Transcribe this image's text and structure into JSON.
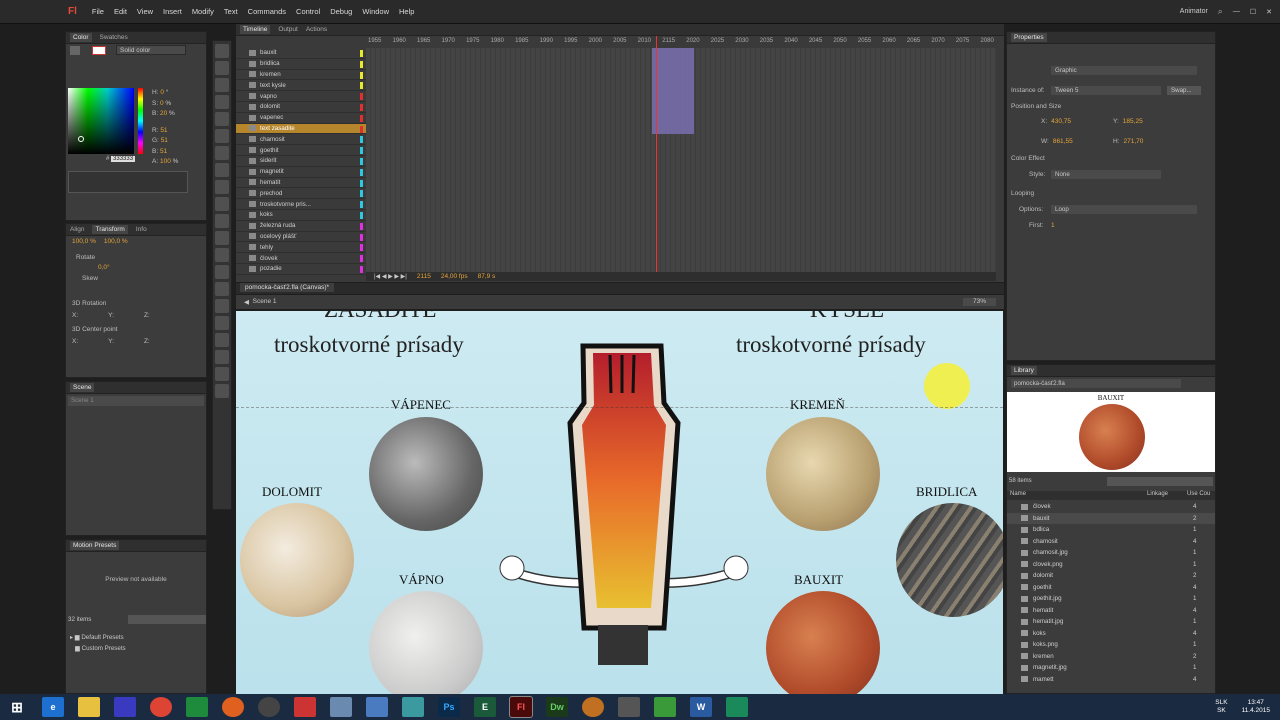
{
  "app": {
    "logo": "Fl",
    "workspace": "Animator"
  },
  "menu": [
    "File",
    "Edit",
    "View",
    "Insert",
    "Modify",
    "Text",
    "Commands",
    "Control",
    "Debug",
    "Window",
    "Help"
  ],
  "color_panel": {
    "tabs": [
      "Color",
      "Swatches"
    ],
    "fill_type": "Solid color",
    "h": "0",
    "s": "0",
    "b": "20",
    "r": "51",
    "g": "51",
    "bl": "51",
    "a": "100",
    "hex": "333333",
    "unit_deg": "°",
    "unit_pct": "%"
  },
  "transform_panel": {
    "tabs": [
      "Align",
      "Transform",
      "Info"
    ],
    "w": "100,0 %",
    "h": "100,0 %",
    "rotate": "Rotate",
    "rotate_val": "0,0°",
    "skew": "Skew",
    "rotation3d": "3D Rotation",
    "center3d": "3D Center point",
    "x": "X:",
    "y": "Y:",
    "z": "Z:"
  },
  "scene_panel": {
    "title": "Scene",
    "item": "Scene 1"
  },
  "motion_presets": {
    "title": "Motion Presets",
    "preview": "Preview not available",
    "count": "32 items",
    "folders": [
      "Default Presets",
      "Custom Presets"
    ]
  },
  "timeline": {
    "tabs": [
      "Timeline",
      "Output",
      "Actions"
    ],
    "ruler": [
      "1955",
      "1960",
      "1965",
      "1970",
      "1975",
      "1980",
      "1985",
      "1990",
      "1995",
      "2000",
      "2005",
      "2010",
      "2115",
      "2020",
      "2025",
      "2030",
      "2035",
      "2040",
      "2045",
      "2050",
      "2055",
      "2060",
      "2065",
      "2070",
      "2075",
      "2080"
    ],
    "layers": [
      {
        "name": "bauxit",
        "color": "#e8e830"
      },
      {
        "name": "bridlica",
        "color": "#e8e830"
      },
      {
        "name": "kremen",
        "color": "#e8e830"
      },
      {
        "name": "text kysle",
        "color": "#e8e830"
      },
      {
        "name": "vapno",
        "color": "#e03030"
      },
      {
        "name": "dolomit",
        "color": "#e03030"
      },
      {
        "name": "vapenec",
        "color": "#e03030"
      },
      {
        "name": "text zasadite",
        "color": "#e03030",
        "selected": true
      },
      {
        "name": "chamosit",
        "color": "#30c8e0"
      },
      {
        "name": "goethit",
        "color": "#30c8e0"
      },
      {
        "name": "siderit",
        "color": "#30c8e0"
      },
      {
        "name": "magnetit",
        "color": "#30c8e0"
      },
      {
        "name": "hematit",
        "color": "#30c8e0"
      },
      {
        "name": "prechod",
        "color": "#30c8e0"
      },
      {
        "name": "troskotvorne pris...",
        "color": "#30c8e0"
      },
      {
        "name": "koks",
        "color": "#30c8e0"
      },
      {
        "name": "železná ruda",
        "color": "#e030e0"
      },
      {
        "name": "ocelový plášť",
        "color": "#e030e0"
      },
      {
        "name": "tehly",
        "color": "#e030e0"
      },
      {
        "name": "človek",
        "color": "#e030e0"
      },
      {
        "name": "pozadie",
        "color": "#e030e0"
      }
    ],
    "frame": "2115",
    "fps": "24,00 fps",
    "time": "87,9 s"
  },
  "document_tab": "pomocka-časť2.fla (Canvas)*",
  "scene_crumb": "Scene 1",
  "zoom": "73%",
  "stage": {
    "heading_left": "ZÁSADITÉ",
    "heading_right": "KYSLÉ",
    "sub_left": "troskotvorné prísady",
    "sub_right": "troskotvorné prísady",
    "labels": [
      "VÁPENEC",
      "DOLOMIT",
      "VÁPNO",
      "KREMEŇ",
      "BRIDLICA",
      "BAUXIT"
    ]
  },
  "properties": {
    "title": "Properties",
    "symbol_type": "Graphic",
    "instance_of_label": "Instance of:",
    "instance_of": "Tween 5",
    "swap": "Swap...",
    "pos_size": "Position and Size",
    "x": "430,75",
    "y": "185,25",
    "w": "861,55",
    "h": "271,70",
    "x_lbl": "X:",
    "y_lbl": "Y:",
    "w_lbl": "W:",
    "h_lbl": "H:",
    "color_effect": "Color Effect",
    "style_label": "Style:",
    "style": "None",
    "looping": "Looping",
    "options_label": "Options:",
    "options": "Loop",
    "first_label": "First:",
    "first": "1"
  },
  "library": {
    "title": "Library",
    "file": "pomocka-časť2.fla",
    "preview_label": "BAUXIT",
    "count": "58 items",
    "cols": [
      "Name",
      "Linkage",
      "Use Cou"
    ],
    "items": [
      {
        "name": "človek",
        "use": "4"
      },
      {
        "name": "bauxit",
        "use": "2",
        "selected": true
      },
      {
        "name": "bdlica",
        "use": "1"
      },
      {
        "name": "chamosit",
        "use": "4"
      },
      {
        "name": "chamosit.jpg",
        "use": "1"
      },
      {
        "name": "clovek.png",
        "use": "1"
      },
      {
        "name": "dolomit",
        "use": "2"
      },
      {
        "name": "goethit",
        "use": "4"
      },
      {
        "name": "goethit.jpg",
        "use": "1"
      },
      {
        "name": "hematit",
        "use": "4"
      },
      {
        "name": "hematit.jpg",
        "use": "1"
      },
      {
        "name": "koks",
        "use": "4"
      },
      {
        "name": "koks.png",
        "use": "1"
      },
      {
        "name": "kremen",
        "use": "2"
      },
      {
        "name": "magnetit.jpg",
        "use": "1"
      },
      {
        "name": "mamett",
        "use": "4"
      }
    ]
  },
  "taskbar": {
    "apps": [
      "e",
      "",
      "",
      "",
      "",
      "",
      "",
      "",
      "Ps",
      "E",
      "Fl",
      "Dw",
      "",
      "",
      "",
      "W",
      ""
    ],
    "lang": "SLK",
    "lang2": "SK",
    "time": "13:47",
    "date": "11.4.2015"
  }
}
